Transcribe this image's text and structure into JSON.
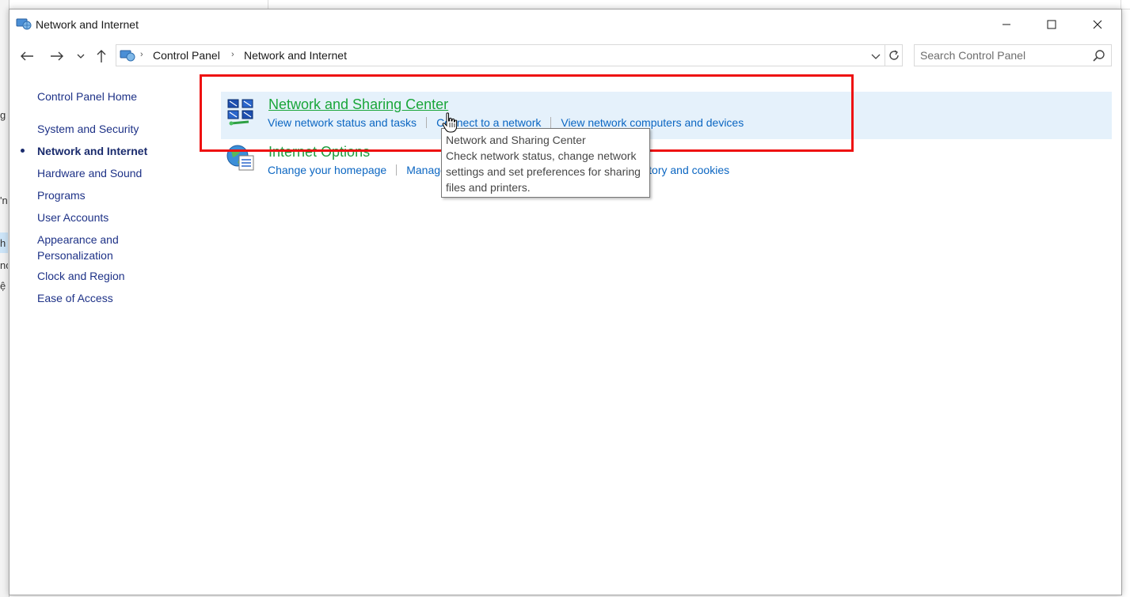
{
  "window": {
    "title": "Network and Internet",
    "controls": {
      "minimize": "minimize",
      "maximize": "maximize",
      "close": "close"
    }
  },
  "background_fragments": [
    "g",
    "'n",
    "h",
    "nc",
    "ệ"
  ],
  "navigation": {
    "breadcrumb": [
      "Control Panel",
      "Network and Internet"
    ],
    "search_placeholder": "Search Control Panel"
  },
  "sidebar": {
    "home": "Control Panel Home",
    "items": [
      {
        "label": "System and Security",
        "active": false
      },
      {
        "label": "Network and Internet",
        "active": true
      },
      {
        "label": "Hardware and Sound",
        "active": false
      },
      {
        "label": "Programs",
        "active": false
      },
      {
        "label": "User Accounts",
        "active": false
      },
      {
        "label": "Appearance and Personalization",
        "active": false
      },
      {
        "label": "Clock and Region",
        "active": false
      },
      {
        "label": "Ease of Access",
        "active": false
      }
    ]
  },
  "categories": [
    {
      "title": "Network and Sharing Center",
      "icon": "network-sharing-icon",
      "links": [
        "View network status and tasks",
        "Connect to a network",
        "View network computers and devices"
      ]
    },
    {
      "title": "Internet Options",
      "icon": "internet-options-icon",
      "links": [
        "Change your homepage",
        "Manage browser add-ons",
        "Delete browsing history and cookies"
      ]
    }
  ],
  "tooltip": {
    "title": "Network and Sharing Center",
    "body": "Check network status, change network settings and set preferences for sharing files and printers."
  },
  "colors": {
    "category_title": "#1e9c3c",
    "link": "#0b66c2",
    "sidebar_link": "#1e3287",
    "hover_bg": "#e5f1fb",
    "highlight": "#ee1111"
  }
}
